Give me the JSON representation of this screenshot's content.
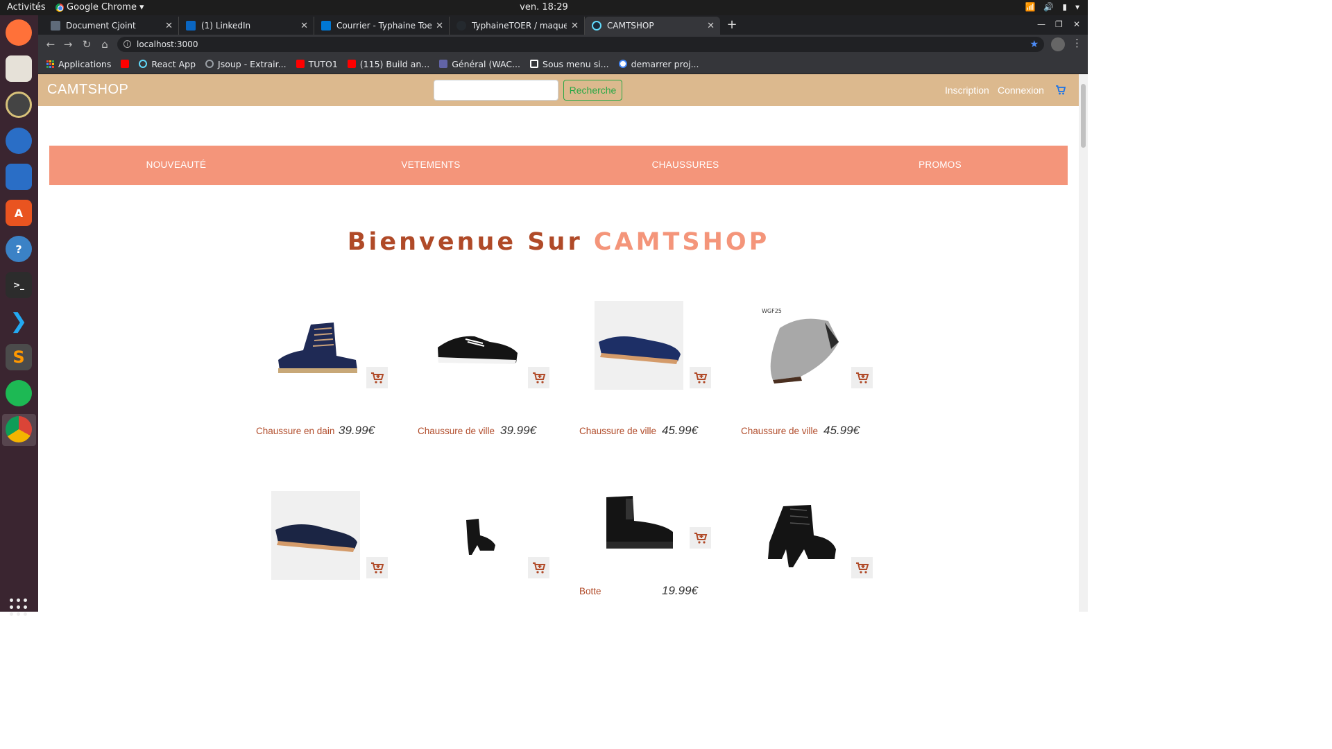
{
  "system": {
    "activities": "Activités",
    "app_name": "Google Chrome",
    "clock": "ven. 18:29"
  },
  "tabs": [
    {
      "title": "Document Cjoint",
      "favicon_color": "#5f6b7a"
    },
    {
      "title": "(1) LinkedIn",
      "favicon_color": "#0a66c2"
    },
    {
      "title": "Courrier - Typhaine Toer -",
      "favicon_color": "#0078d4"
    },
    {
      "title": "TyphaineTOER / maquette",
      "favicon_color": "#24292e"
    },
    {
      "title": "CAMTSHOP",
      "favicon_color": "#61dafb"
    }
  ],
  "address_bar": {
    "url": "localhost:3000"
  },
  "bookmarks": [
    {
      "label": "Applications",
      "icon_color": "#ea4335"
    },
    {
      "label": "",
      "icon_color": "#ff0000"
    },
    {
      "label": "React App",
      "icon_color": "#61dafb"
    },
    {
      "label": "Jsoup - Extrair...",
      "icon_color": "#9aa0a6"
    },
    {
      "label": "TUTO1",
      "icon_color": "#ff0000"
    },
    {
      "label": "(115) Build an...",
      "icon_color": "#ff0000"
    },
    {
      "label": "Général (WAC...",
      "icon_color": "#6264a7"
    },
    {
      "label": "Sous menu si...",
      "icon_color": "#ffffff"
    },
    {
      "label": "demarrer proj...",
      "icon_color": "#4285f4"
    }
  ],
  "site": {
    "brand": "CAMTSHOP",
    "search_placeholder": "",
    "search_button": "Recherche",
    "signup": "Inscription",
    "login": "Connexion",
    "categories": [
      "NOUVEAUTÉ",
      "VETEMENTS",
      "CHAUSSURES",
      "PROMOS"
    ],
    "welcome_part1": "Bienvenue Sur",
    "welcome_part2": "CAMTSHOP",
    "colors": {
      "header": "#dcb98e",
      "nav": "#f4957a",
      "accent": "#b04a28",
      "button_green": "#28a745"
    }
  },
  "products": [
    {
      "name": "Chaussure en dain",
      "price": "39.99€",
      "image": "navy-suede-boot"
    },
    {
      "name": "Chaussure de ville",
      "price": "39.99€",
      "image": "black-sneaker"
    },
    {
      "name": "Chaussure de ville",
      "price": "45.99€",
      "image": "navy-derby"
    },
    {
      "name": "Chaussure de ville",
      "price": "45.99€",
      "image": "grey-suede-derby",
      "image_caption": "WGF25"
    },
    {
      "name": "",
      "price": "",
      "image": "navy-derby-2"
    },
    {
      "name": "",
      "price": "",
      "image": "black-ankle-boot"
    },
    {
      "name": "Botte",
      "price": "19.99€",
      "image": "black-chelsea-boot"
    },
    {
      "name": "",
      "price": "",
      "image": "black-lace-heel-boot"
    }
  ]
}
